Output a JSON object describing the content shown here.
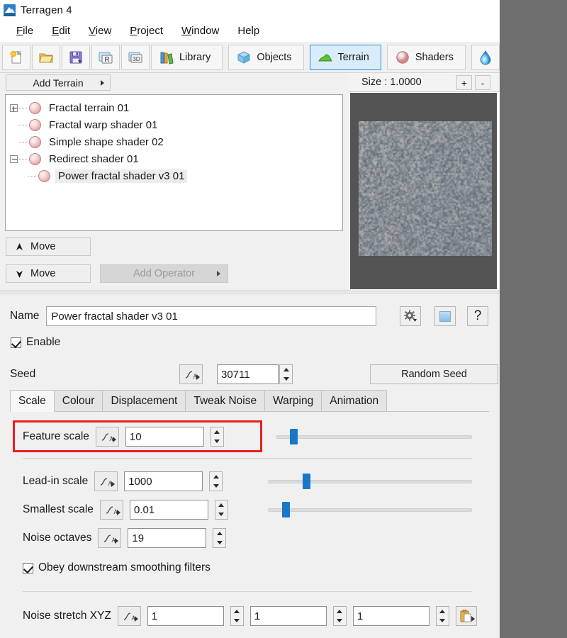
{
  "window": {
    "title": "Terragen 4",
    "app_icon": "terragen-mountain-icon"
  },
  "menu": {
    "items": [
      {
        "label": "File",
        "accel": "F"
      },
      {
        "label": "Edit",
        "accel": "E"
      },
      {
        "label": "View",
        "accel": "V"
      },
      {
        "label": "Project",
        "accel": "P"
      },
      {
        "label": "Window",
        "accel": "W"
      },
      {
        "label": "Help",
        "accel": "H"
      }
    ]
  },
  "toolbar": {
    "icon_buttons": [
      {
        "name": "new-project-icon",
        "title": "New"
      },
      {
        "name": "open-project-icon",
        "title": "Open"
      },
      {
        "name": "save-project-icon",
        "title": "Save"
      },
      {
        "name": "render-icon",
        "title": "Render"
      },
      {
        "name": "3d-preview-icon",
        "title": "3D"
      }
    ],
    "tabs": [
      {
        "label": "Library",
        "icon": "library-books-icon",
        "active": false
      },
      {
        "label": "Objects",
        "icon": "cube-icon",
        "active": false
      },
      {
        "label": "Terrain",
        "icon": "terrain-hill-icon",
        "active": true
      },
      {
        "label": "Shaders",
        "icon": "sphere-icon",
        "active": false
      },
      {
        "label": "",
        "icon": "water-droplet-icon",
        "active": false
      }
    ],
    "active_color": "#d8ecfb",
    "active_border": "#2a8ed6"
  },
  "terrain_panel": {
    "add_terrain_label": "Add Terrain",
    "tree_items": [
      {
        "label": "Fractal terrain 01",
        "expander": "plus",
        "depth": 0,
        "selected": false
      },
      {
        "label": "Fractal warp shader 01",
        "expander": "none",
        "depth": 0,
        "selected": false
      },
      {
        "label": "Simple shape shader 02",
        "expander": "none",
        "depth": 0,
        "selected": false
      },
      {
        "label": "Redirect shader 01",
        "expander": "minus",
        "depth": 0,
        "selected": false
      },
      {
        "label": "Power fractal shader v3 01",
        "expander": "none",
        "depth": 1,
        "selected": true
      }
    ],
    "move_up_label": "Move",
    "move_down_label": "Move",
    "add_operator_label": "Add Operator",
    "add_operator_enabled": false
  },
  "preview": {
    "size_label": "Size : 1.0000",
    "zoom_in_label": "+",
    "zoom_out_label": "-",
    "thumbnail": "fractal-noise-thumbnail"
  },
  "params": {
    "name_label": "Name",
    "name_value": "Power fractal shader v3 01",
    "gear_icon": "gear-icon",
    "preview_icon": "preview-swatch-icon",
    "help_label": "?",
    "enable_label": "Enable",
    "enable_checked": true,
    "seed_label": "Seed",
    "seed_value": "30711",
    "random_seed_label": "Random Seed",
    "tabs": [
      {
        "label": "Scale",
        "active": true
      },
      {
        "label": "Colour",
        "active": false
      },
      {
        "label": "Displacement",
        "active": false
      },
      {
        "label": "Tweak Noise",
        "active": false
      },
      {
        "label": "Warping",
        "active": false
      },
      {
        "label": "Animation",
        "active": false
      }
    ],
    "scale_rows": [
      {
        "label": "Feature scale",
        "value": "10",
        "slider": true,
        "slider_pct": 7,
        "highlighted": true
      },
      {
        "label": "Lead-in scale",
        "value": "1000",
        "slider": true,
        "slider_pct": 17,
        "highlighted": false
      },
      {
        "label": "Smallest scale",
        "value": "0.01",
        "slider": true,
        "slider_pct": 7,
        "highlighted": false
      },
      {
        "label": "Noise octaves",
        "value": "19",
        "slider": false,
        "slider_pct": 0,
        "highlighted": false
      }
    ],
    "obey_label": "Obey downstream smoothing filters",
    "obey_checked": true,
    "noise_stretch_label": "Noise stretch XYZ",
    "noise_stretch_x": "1",
    "noise_stretch_y": "1",
    "noise_stretch_z": "1",
    "clipboard_icon": "clipboard-icon",
    "highlight_color": "#ef1d1d"
  }
}
